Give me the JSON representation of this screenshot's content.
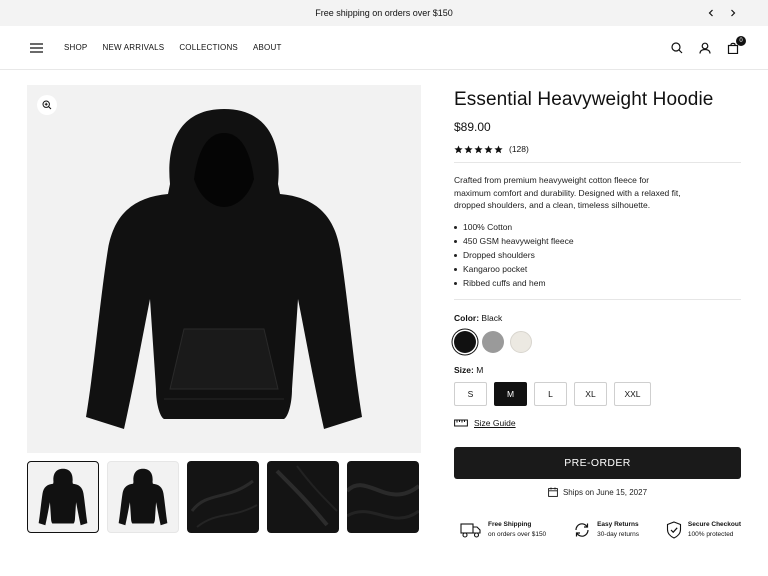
{
  "announcement": {
    "text": "Free shipping on orders over $150"
  },
  "nav": {
    "items": [
      "SHOP",
      "NEW ARRIVALS",
      "COLLECTIONS",
      "ABOUT"
    ]
  },
  "cart": {
    "count": "0"
  },
  "product": {
    "title": "Essential Heavyweight Hoodie",
    "price": "$89.00",
    "review_count": "(128)",
    "rating_stars": 5,
    "description": "Crafted from premium heavyweight cotton fleece for maximum comfort and durability. Designed with a relaxed fit, dropped shoulders, and a clean, timeless silhouette.",
    "features": [
      "100% Cotton",
      "450 GSM heavyweight fleece",
      "Dropped shoulders",
      "Kangaroo pocket",
      "Ribbed cuffs and hem"
    ],
    "color_label": "Color:",
    "color_value": "Black",
    "colors": [
      {
        "name": "black",
        "hex": "#111111"
      },
      {
        "name": "grey",
        "hex": "#9a9a9a"
      },
      {
        "name": "cream",
        "hex": "#ece9e2"
      }
    ],
    "size_label": "Size:",
    "size_value": "M",
    "sizes": [
      "S",
      "M",
      "L",
      "XL",
      "XXL"
    ],
    "size_guide": "Size Guide",
    "cta": "PRE-ORDER",
    "ships": "Ships on June 15, 2027"
  },
  "badges": [
    {
      "title": "Free Shipping",
      "sub": "on orders over $150",
      "icon": "truck-icon"
    },
    {
      "title": "Easy Returns",
      "sub": "30-day returns",
      "icon": "refresh-icon"
    },
    {
      "title": "Secure Checkout",
      "sub": "100% protected",
      "icon": "shield-check-icon"
    }
  ],
  "colors": {
    "accent": "#111111",
    "page_bg": "#ffffff",
    "image_bg": "#f2f2f2",
    "announce_bg": "#f3f3f3"
  }
}
